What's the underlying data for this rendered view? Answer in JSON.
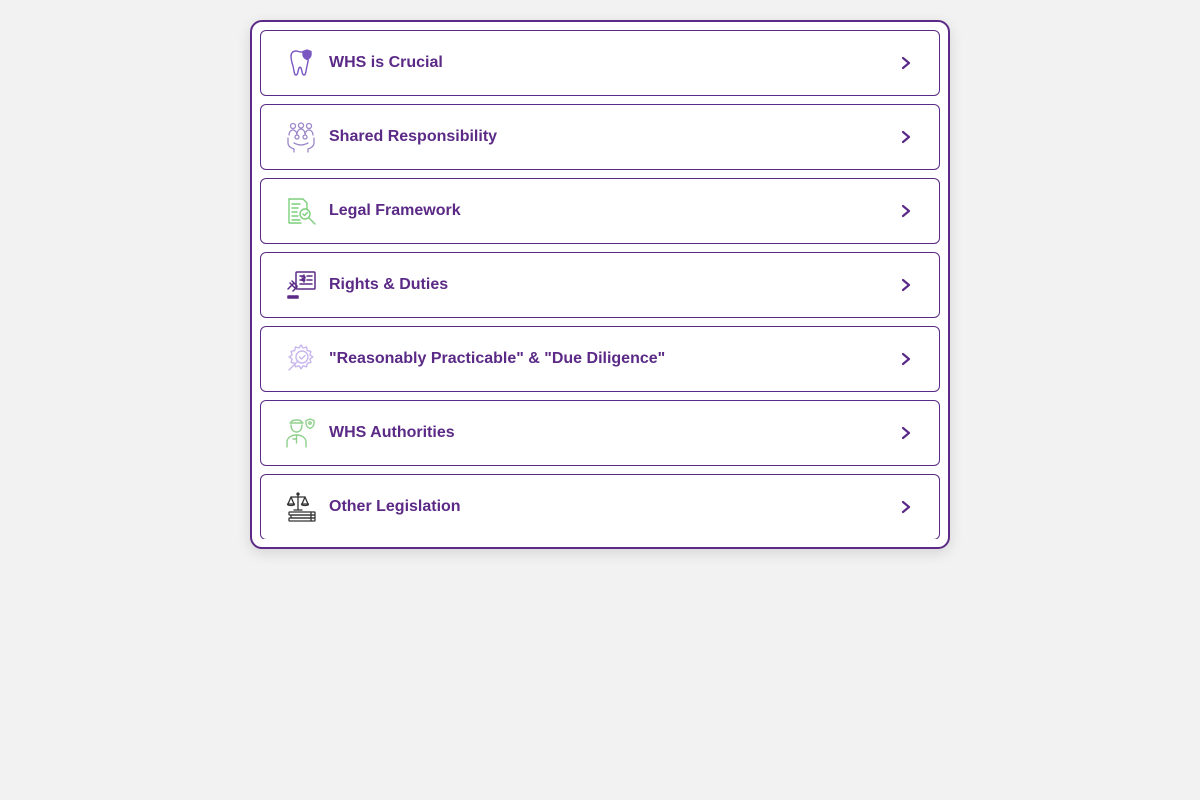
{
  "accordion": {
    "items": [
      {
        "label": "WHS is Crucial",
        "icon": "tooth-shield-icon",
        "icon_color": "#7a58c2"
      },
      {
        "label": "Shared Responsibility",
        "icon": "people-hands-icon",
        "icon_color": "#9b87c9"
      },
      {
        "label": "Legal Framework",
        "icon": "document-magnifier-icon",
        "icon_color": "#7ccf7a"
      },
      {
        "label": "Rights & Duties",
        "icon": "gavel-document-icon",
        "icon_color": "#5b2a86"
      },
      {
        "label": "\"Reasonably Practicable\" & \"Due Diligence\"",
        "icon": "gear-magnifier-icon",
        "icon_color": "#c8b6ee"
      },
      {
        "label": "WHS Authorities",
        "icon": "officer-shield-icon",
        "icon_color": "#8fd08c"
      },
      {
        "label": "Other Legislation",
        "icon": "scales-books-icon",
        "icon_color": "#333333"
      }
    ]
  },
  "colors": {
    "accent": "#5b2a86",
    "background": "#f2f2f2",
    "panel": "#ffffff"
  }
}
